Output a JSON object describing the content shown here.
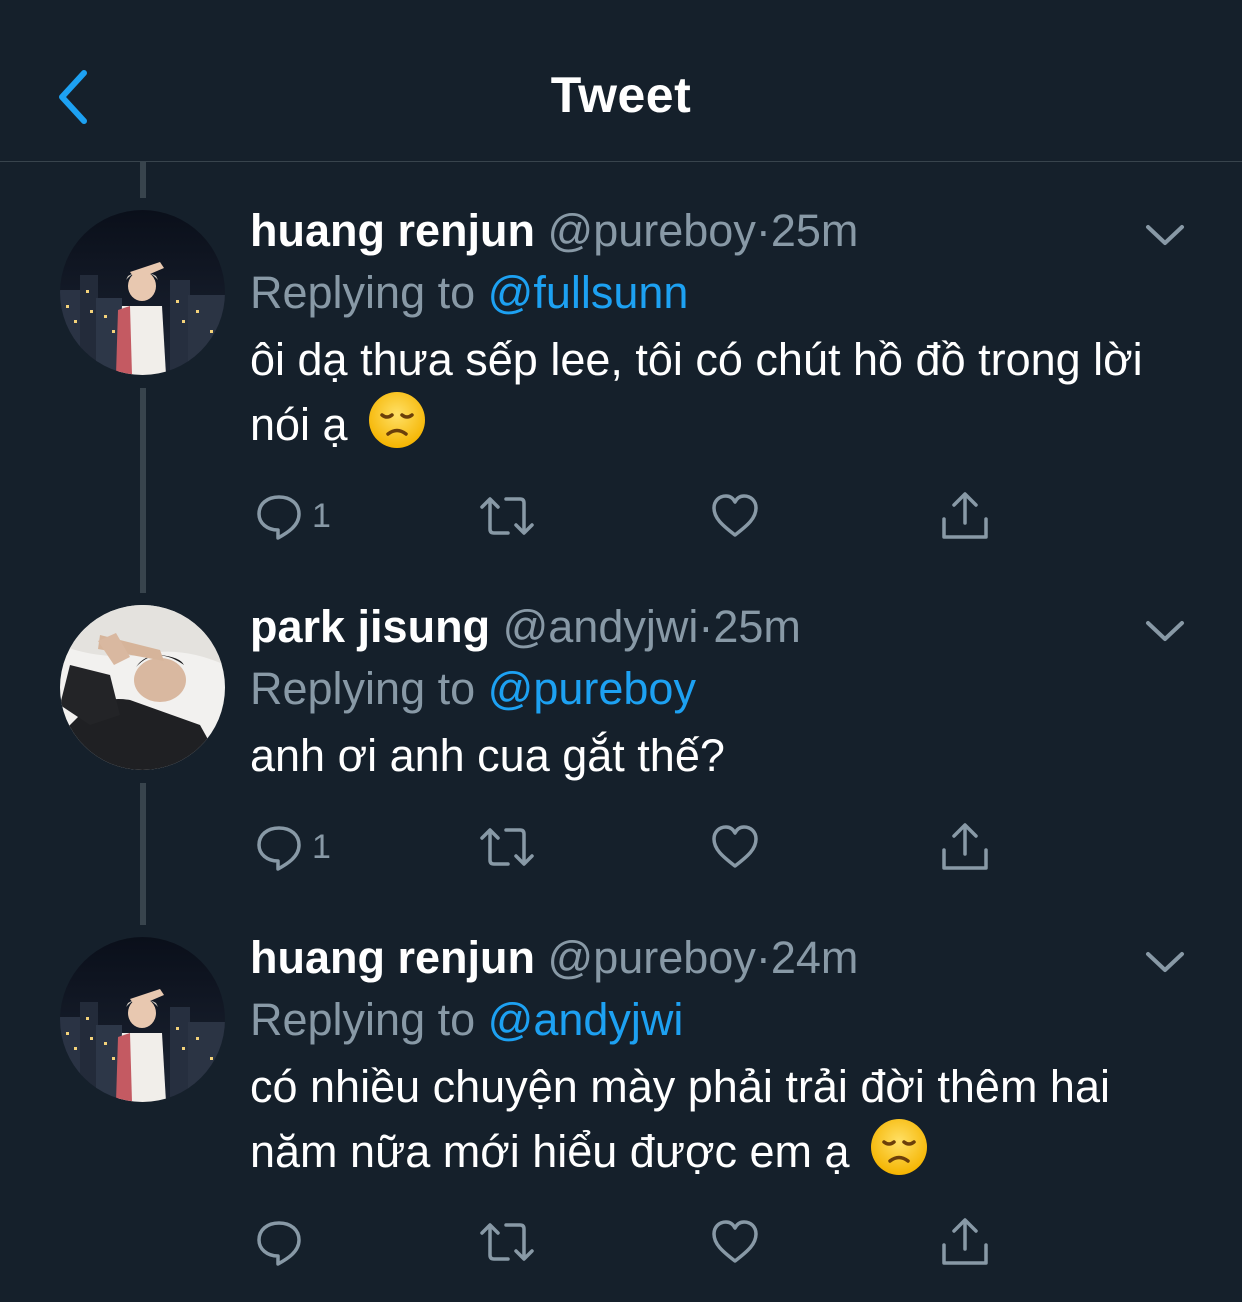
{
  "header": {
    "title": "Tweet",
    "back_icon": "chevron-left-icon",
    "accent": "#1da1f2"
  },
  "colors": {
    "background": "#15202b",
    "secondary": "#8899a6",
    "link": "#1da1f2",
    "divider": "#38444d"
  },
  "tweets": [
    {
      "name": "huang renjun",
      "handle": "@pureboy",
      "dot": "·",
      "time": "25m",
      "replying_prefix": "Replying to",
      "replying_to": "@fullsunn",
      "text": "ôi dạ thưa sếp lee, tôi có chút hồ đồ trong lời nói ạ",
      "emoji": "disappointed-face-emoji",
      "reply_count": "1"
    },
    {
      "name": "park jisung",
      "handle": "@andyjwi",
      "dot": "·",
      "time": "25m",
      "replying_prefix": "Replying to",
      "replying_to": "@pureboy",
      "text": "anh ơi anh cua gắt thế?",
      "reply_count": "1"
    },
    {
      "name": "huang renjun",
      "handle": "@pureboy",
      "dot": "·",
      "time": "24m",
      "replying_prefix": "Replying to",
      "replying_to": "@andyjwi",
      "text": "có nhiều chuyện mày phải trải đời thêm hai năm nữa mới hiểu được em ạ",
      "emoji": "disappointed-face-emoji",
      "reply_count": ""
    }
  ],
  "actions": [
    "reply-icon",
    "retweet-icon",
    "like-icon",
    "share-icon"
  ]
}
